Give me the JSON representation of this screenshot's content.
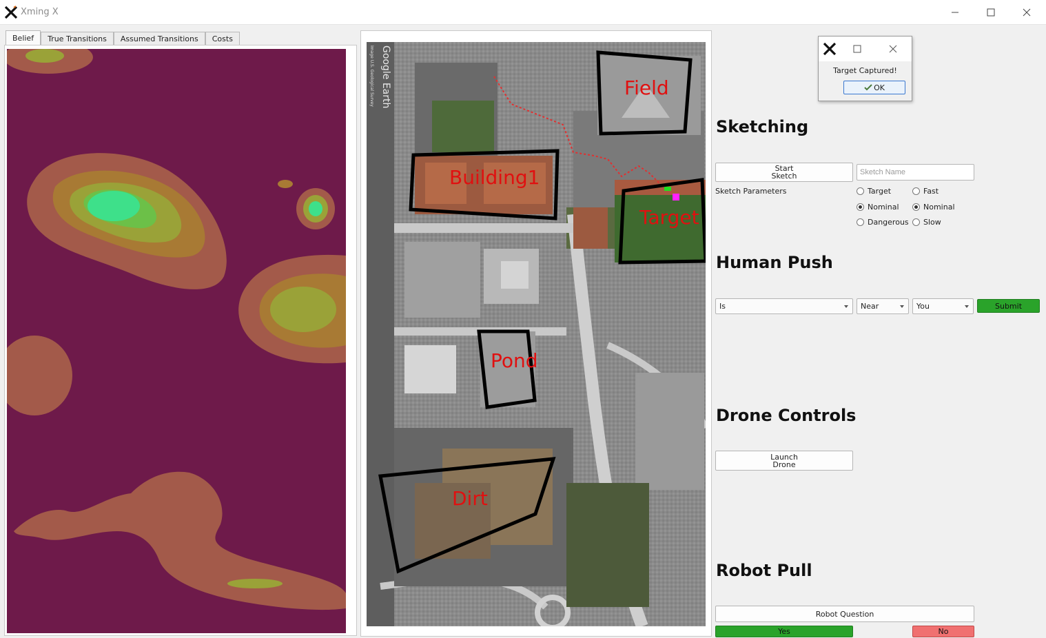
{
  "window": {
    "title": "Xming X"
  },
  "tabs": [
    {
      "label": "Belief",
      "active": true
    },
    {
      "label": "True Transitions",
      "active": false
    },
    {
      "label": "Assumed Transitions",
      "active": false
    },
    {
      "label": "Costs",
      "active": false
    }
  ],
  "map": {
    "watermark": "Google Earth",
    "watermark_sub": "Image U.S. Geological Survey",
    "regions": [
      "Field",
      "Building1",
      "Target",
      "Pond",
      "Dirt"
    ]
  },
  "sketching": {
    "heading": "Sketching",
    "start_button": "Start\nSketch",
    "start_line1": "Start",
    "start_line2": "Sketch",
    "name_placeholder": "Sketch Name",
    "params_label": "Sketch Parameters",
    "type_options": [
      "Target",
      "Nominal",
      "Dangerous"
    ],
    "type_selected": "Nominal",
    "speed_options": [
      "Fast",
      "Nominal",
      "Slow"
    ],
    "speed_selected": "Nominal"
  },
  "human_push": {
    "heading": "Human Push",
    "relation": "Is",
    "proximity": "Near",
    "reference": "You",
    "submit": "Submit"
  },
  "drone_controls": {
    "heading": "Drone Controls",
    "launch_line1": "Launch",
    "launch_line2": "Drone"
  },
  "robot_pull": {
    "heading": "Robot Pull",
    "question": "Robot Question",
    "yes": "Yes",
    "no": "No"
  },
  "dialog": {
    "message": "Target Captured!",
    "ok": "OK"
  },
  "colors": {
    "belief_bg": "#6e1a4a",
    "belief_level1": "#a35a4a",
    "belief_level2": "#a87a34",
    "belief_level3": "#9aa238",
    "belief_level4": "#6cc048",
    "belief_level5": "#3ee08a",
    "region_label": "#e01010",
    "submit_green": "#2aa32a",
    "yes_green": "#2aa32a",
    "no_red": "#f07070"
  }
}
